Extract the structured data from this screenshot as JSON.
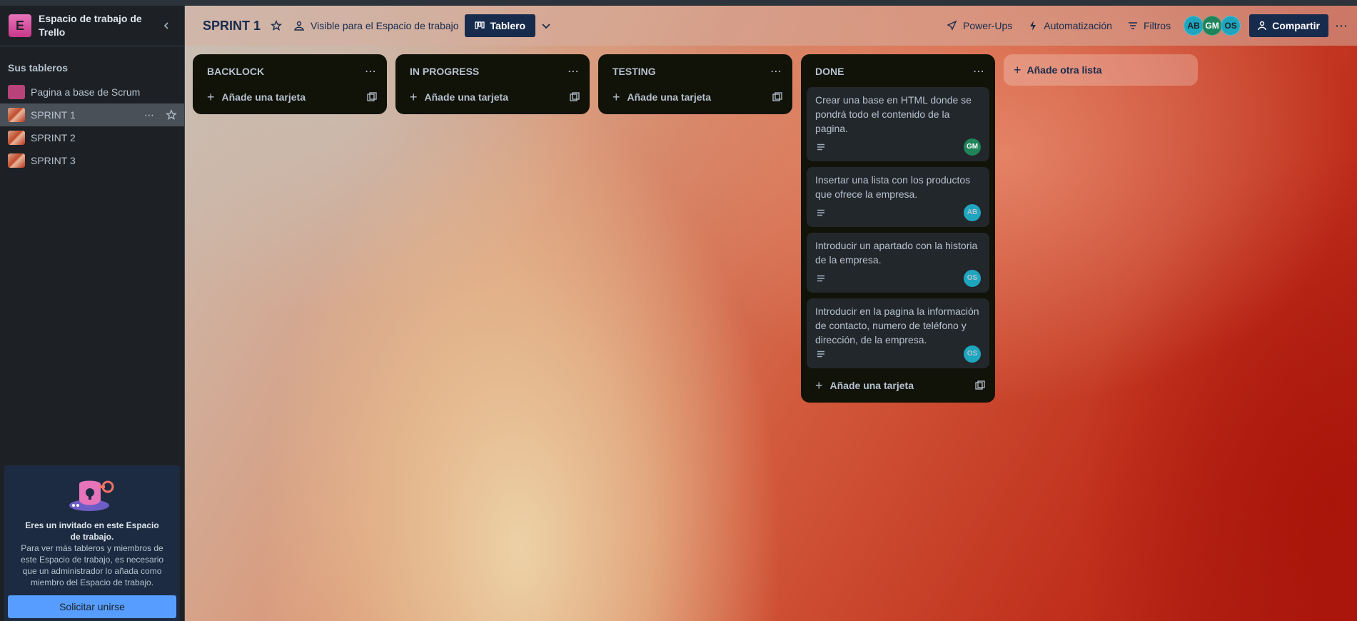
{
  "workspace": {
    "initial": "E",
    "name": "Espacio de trabajo de Trello"
  },
  "sidebar": {
    "section_title": "Sus tableros",
    "boards": [
      {
        "label": "Pagina a base de Scrum",
        "active": false
      },
      {
        "label": "SPRINT 1",
        "active": true
      },
      {
        "label": "SPRINT 2",
        "active": false
      },
      {
        "label": "SPRINT 3",
        "active": false
      }
    ],
    "guest": {
      "title": "Eres un invitado en este Espacio de trabajo.",
      "text": "Para ver más tableros y miembros de este Espacio de trabajo, es necesario que un administrador lo añada como miembro del Espacio de trabajo.",
      "button": "Solicitar unirse"
    }
  },
  "header": {
    "board_title": "SPRINT 1",
    "visibility": "Visible para el Espacio de trabajo",
    "view": "Tablero",
    "powerups": "Power-Ups",
    "automation": "Automatización",
    "filters": "Filtros",
    "members": [
      "AB",
      "GM",
      "OS"
    ],
    "share": "Compartir"
  },
  "lists": [
    {
      "title": "BACKLOCK",
      "add_card": "Añade una tarjeta",
      "cards": []
    },
    {
      "title": "IN PROGRESS",
      "add_card": "Añade una tarjeta",
      "cards": []
    },
    {
      "title": "TESTING",
      "add_card": "Añade una tarjeta",
      "cards": []
    },
    {
      "title": "DONE",
      "add_card": "Añade una tarjeta",
      "cards": [
        {
          "text": "Crear una base en HTML donde se pondrá todo el contenido de la pagina.",
          "member": "GM"
        },
        {
          "text": "Insertar una lista con los productos que ofrece la empresa.",
          "member": "AB"
        },
        {
          "text": "Introducir un apartado con la historia de la empresa.",
          "member": "OS"
        },
        {
          "text": "Introducir en la pagina la información de contacto, numero de teléfono y dirección, de la empresa.",
          "member": "OS"
        }
      ]
    }
  ],
  "add_list": "Añade otra lista",
  "colors": {
    "accent": "#579dff",
    "header_button": "#172b4d",
    "list_bg": "#111208",
    "card_bg": "#22272b",
    "member_ab": "#1fa6bf",
    "member_gm": "#1f845a",
    "member_os": "#1fa6bf"
  }
}
